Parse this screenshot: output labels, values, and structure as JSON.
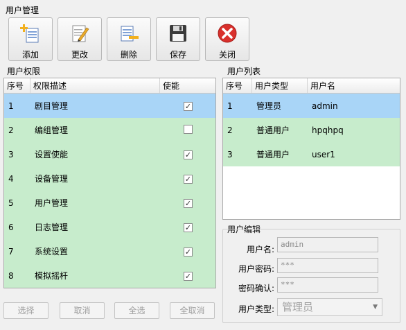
{
  "window": {
    "title": "用户管理"
  },
  "toolbar": {
    "buttons": [
      {
        "label": "添加",
        "icon": "add-icon"
      },
      {
        "label": "更改",
        "icon": "edit-icon"
      },
      {
        "label": "删除",
        "icon": "delete-icon"
      },
      {
        "label": "保存",
        "icon": "save-icon"
      },
      {
        "label": "关闭",
        "icon": "close-icon"
      }
    ]
  },
  "permissions": {
    "title": "用户权限",
    "columns": [
      "序号",
      "权限描述",
      "使能"
    ],
    "rows": [
      {
        "no": "1",
        "desc": "剧目管理",
        "enabled": true
      },
      {
        "no": "2",
        "desc": "编组管理",
        "enabled": false
      },
      {
        "no": "3",
        "desc": "设置使能",
        "enabled": true
      },
      {
        "no": "4",
        "desc": "设备管理",
        "enabled": true
      },
      {
        "no": "5",
        "desc": "用户管理",
        "enabled": true
      },
      {
        "no": "6",
        "desc": "日志管理",
        "enabled": true
      },
      {
        "no": "7",
        "desc": "系统设置",
        "enabled": true
      },
      {
        "no": "8",
        "desc": "模拟摇杆",
        "enabled": true
      }
    ],
    "selected_row": 0
  },
  "bottom_buttons": {
    "select": "选择",
    "cancel": "取消",
    "select_all": "全选",
    "deselect_all": "全取消"
  },
  "users": {
    "title": "用户列表",
    "columns": [
      "序号",
      "用户类型",
      "用户名"
    ],
    "rows": [
      {
        "no": "1",
        "type": "管理员",
        "name": "admin"
      },
      {
        "no": "2",
        "type": "普通用户",
        "name": "hpqhpq"
      },
      {
        "no": "3",
        "type": "普通用户",
        "name": "user1"
      }
    ],
    "selected_row": 0
  },
  "edit": {
    "title": "用户编辑",
    "username_label": "用户名:",
    "username_value": "admin",
    "password_label": "用户密码:",
    "password_value": "***",
    "confirm_label": "密码确认:",
    "confirm_value": "***",
    "type_label": "用户类型:",
    "type_value": "管理员"
  },
  "colors": {
    "row_green": "#c7eccc",
    "row_selected": "#a9d5f7"
  }
}
